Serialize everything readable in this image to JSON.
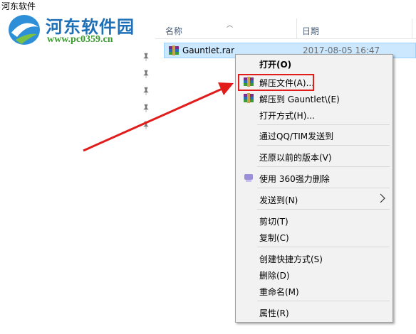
{
  "window": {
    "title": "河东软件"
  },
  "watermark": {
    "site_name": "河东软件园",
    "url": "www.pc0359.cn"
  },
  "file_list": {
    "columns": {
      "name": "名称",
      "date": "日期"
    },
    "rows": [
      {
        "name": "Gauntlet.rar",
        "date": "2017-08-05 16:47"
      }
    ]
  },
  "context_menu": {
    "items": [
      {
        "label": "打开(O)",
        "bold": true
      },
      {
        "label": "解压文件(A)...",
        "icon": "winrar-icon",
        "highlighted": true
      },
      {
        "label": "解压到 Gauntlet\\(E)",
        "icon": "winrar-icon"
      },
      {
        "label": "打开方式(H)..."
      },
      {
        "label": "通过QQ/TIM发送到"
      },
      {
        "label": "还原以前的版本(V)"
      },
      {
        "label": "使用 360强力删除",
        "icon": "360-shred-icon"
      },
      {
        "label": "发送到(N)",
        "submenu": true
      },
      {
        "label": "剪切(T)"
      },
      {
        "label": "复制(C)"
      },
      {
        "label": "创建快捷方式(S)"
      },
      {
        "label": "删除(D)"
      },
      {
        "label": "重命名(M)"
      },
      {
        "label": "属性(R)"
      }
    ]
  },
  "colors": {
    "selection_bg": "#cce8ff",
    "annotation_red": "#e21b1b",
    "menu_bg": "#f2f2f2"
  }
}
